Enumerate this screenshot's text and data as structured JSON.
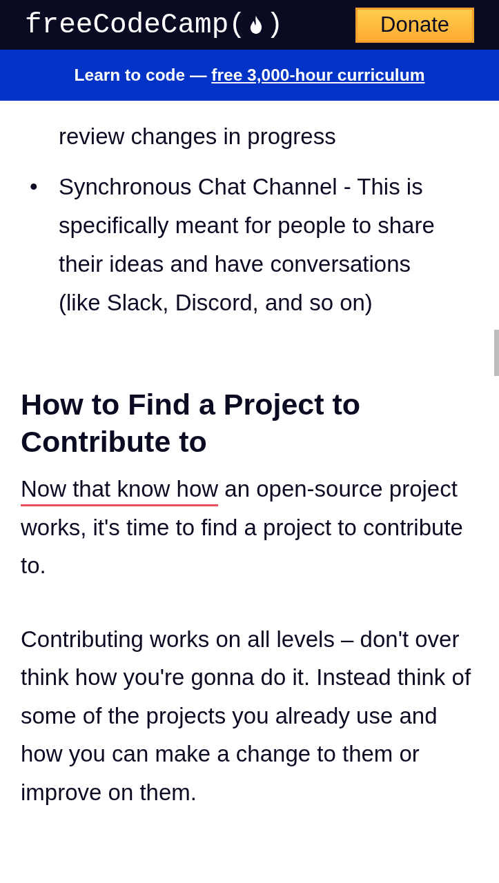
{
  "navbar": {
    "brand": "freeCodeCamp",
    "brand_open": "(",
    "brand_close": ")",
    "donate_button": "Donate"
  },
  "banner": {
    "text": "Learn to code — ",
    "link": "free 3,000-hour curriculum"
  },
  "list_items": [
    {
      "text": "review changes in progress"
    },
    {
      "marker": "•",
      "text": "Synchronous Chat Channel - This is specifically meant for people to share their ideas and have conversations (like Slack, Discord, and so on)"
    }
  ],
  "heading": "How to Find a Project to Contribute to",
  "paragraphs": [
    {
      "flagged": "Now that know how",
      "text": " an open-source project works, it's time to find a project to contribute to."
    },
    {
      "text": "Contributing works on all levels – don't over think how you're gonna do it. Instead think of some of the projects you already use and how you can make a change to them or improve on them."
    }
  ]
}
